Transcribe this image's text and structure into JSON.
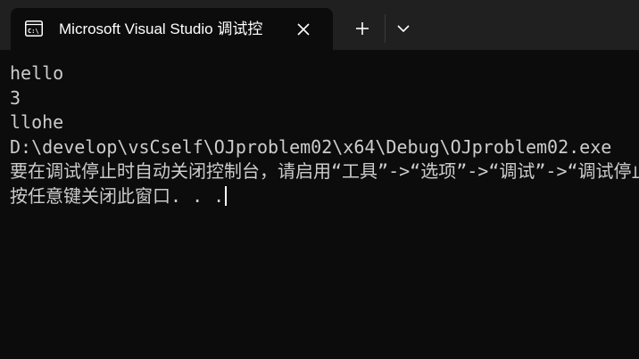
{
  "tab": {
    "title": "Microsoft Visual Studio 调试控",
    "icon": "console-icon",
    "close_icon": "close-icon"
  },
  "toolbar": {
    "new_tab_icon": "plus-icon",
    "dropdown_icon": "chevron-down-icon"
  },
  "console": {
    "lines": [
      "hello",
      "3",
      "llohe",
      "D:\\develop\\vsCself\\OJproblem02\\x64\\Debug\\OJproblem02.exe",
      "要在调试停止时自动关闭控制台，请启用“工具”->“选项”->“调试”->“调试停止时自动关闭控制台”。",
      "按任意键关闭此窗口. . ."
    ]
  },
  "colors": {
    "titlebar": "#202020",
    "background": "#0c0c0c",
    "text": "#cccccc"
  }
}
